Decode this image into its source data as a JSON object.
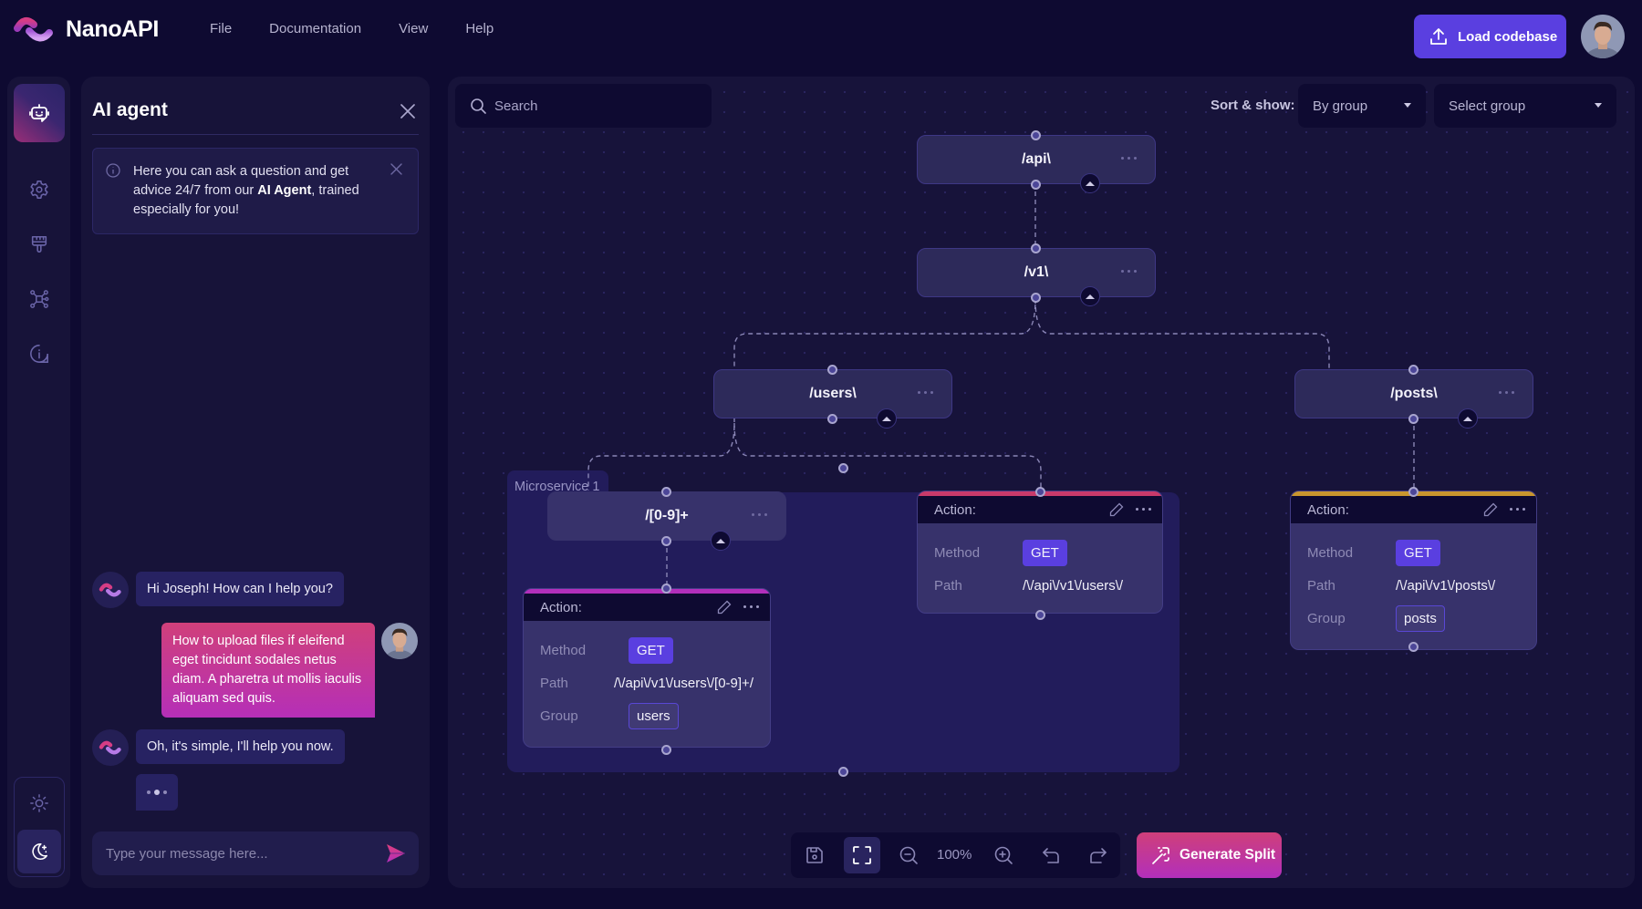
{
  "app": {
    "brand": "NanoAPI",
    "menu": [
      "File",
      "Documentation",
      "View",
      "Help"
    ],
    "load_button": "Load codebase",
    "colors": {
      "accent": "#5a3fe0",
      "pink": "#d0407a",
      "magenta": "#b22fbb",
      "bg": "#0e0a31",
      "panel": "#171339"
    }
  },
  "rail": {
    "items": [
      {
        "icon": "robot-icon",
        "label": "AI agent",
        "active": true
      },
      {
        "icon": "gear-icon",
        "label": "Settings",
        "active": false
      },
      {
        "icon": "paintbrush-icon",
        "label": "Theme",
        "active": false
      },
      {
        "icon": "network-icon",
        "label": "Graph",
        "active": false
      },
      {
        "icon": "info-icon",
        "label": "Info",
        "active": false
      }
    ],
    "theme": {
      "light_icon": "sun-icon",
      "dark_icon": "moon-icon",
      "selected": "dark"
    }
  },
  "agent": {
    "title": "AI agent",
    "info": {
      "pre": "Here you can ask a question and get advice 24/7 from our ",
      "bold": "AI Agent",
      "post": ", trained especially for you!"
    },
    "messages": [
      {
        "from": "bot",
        "text": "Hi Joseph! How can I help you?"
      },
      {
        "from": "user",
        "text": "How to upload files if eleifend eget tincidunt sodales netus diam. A pharetra ut mollis iaculis aliquam sed quis."
      },
      {
        "from": "bot",
        "text": "Oh, it's simple, I'll help you now."
      }
    ],
    "typing": true,
    "input_placeholder": "Type your message here..."
  },
  "canvas": {
    "search_placeholder": "Search",
    "sort_label": "Sort & show:",
    "sort_value": "By group",
    "group_select_placeholder": "Select group",
    "group_label": "Microservice 1",
    "nodes": {
      "api": "/api\\",
      "v1": "/v1\\",
      "users": "/users\\",
      "posts": "/posts\\",
      "id": "/[0-9]+"
    },
    "actions": [
      {
        "id": "users-id",
        "title": "Action:",
        "accent": "#b22fbb",
        "method": "GET",
        "path": "/\\/api\\/v1\\/users\\/[0-9]+/",
        "group": "users"
      },
      {
        "id": "users",
        "title": "Action:",
        "accent": "#c93a6a",
        "method": "GET",
        "path": "/\\/api\\/v1\\/users\\/",
        "group": null
      },
      {
        "id": "posts",
        "title": "Action:",
        "accent": "#c9962e",
        "method": "GET",
        "path": "/\\/api\\/v1\\/posts\\/",
        "group": "posts"
      }
    ],
    "labels": {
      "method": "Method",
      "path": "Path",
      "group": "Group"
    },
    "toolbar": {
      "zoom": "100%"
    },
    "generate_button": "Generate Split"
  }
}
